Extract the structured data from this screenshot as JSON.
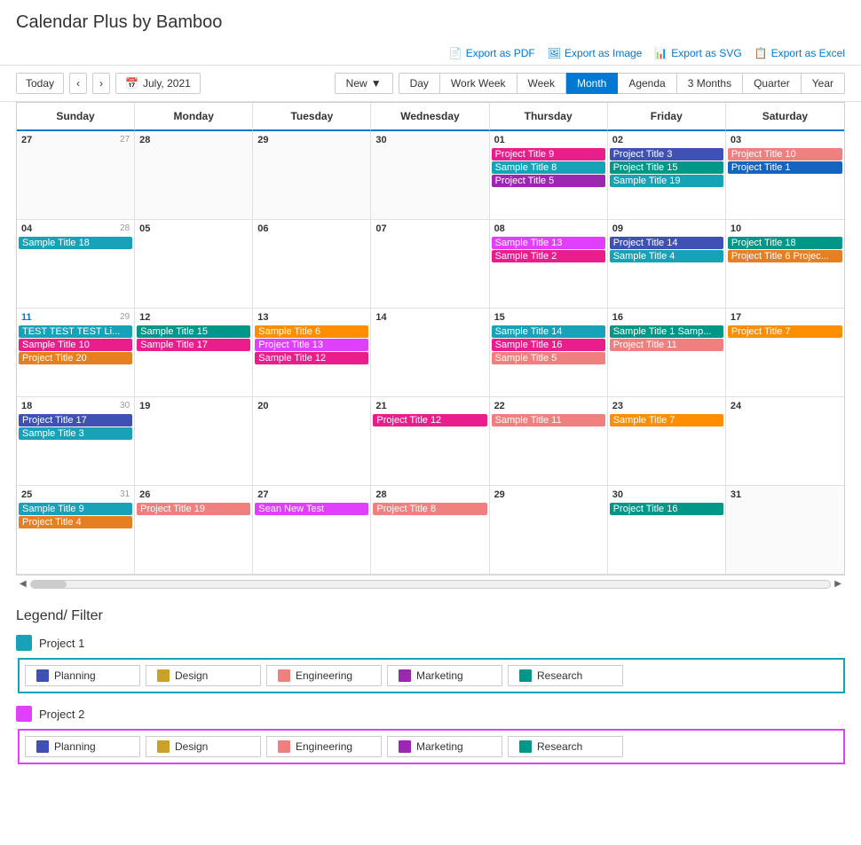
{
  "app": {
    "title": "Calendar Plus by Bamboo"
  },
  "toolbar": {
    "export_pdf": "Export as PDF",
    "export_image": "Export as Image",
    "export_svg": "Export as SVG",
    "export_excel": "Export as Excel"
  },
  "nav": {
    "today": "Today",
    "prev": "‹",
    "next": "›",
    "current_date": "July, 2021",
    "new_label": "New",
    "views": [
      "Day",
      "Work Week",
      "Week",
      "Month",
      "Agenda",
      "3 Months",
      "Quarter",
      "Year"
    ],
    "active_view": "Month"
  },
  "calendar": {
    "headers": [
      "Sunday",
      "Monday",
      "Tuesday",
      "Wednesday",
      "Thursday",
      "Friday",
      "Saturday"
    ],
    "weeks": [
      {
        "week_num": "27",
        "days": [
          {
            "num": "27",
            "other": true,
            "events": []
          },
          {
            "num": "28",
            "other": true,
            "events": []
          },
          {
            "num": "29",
            "other": true,
            "events": []
          },
          {
            "num": "30",
            "other": true,
            "events": []
          },
          {
            "num": "01",
            "events": [
              {
                "label": "Project Title 9",
                "color": "ev-pink"
              },
              {
                "label": "Sample Title 8",
                "color": "ev-cyan"
              },
              {
                "label": "Project Title 5",
                "color": "ev-purple"
              }
            ]
          },
          {
            "num": "02",
            "events": [
              {
                "label": "Project Title 3",
                "color": "ev-blue"
              },
              {
                "label": "Project Title 15",
                "color": "ev-teal"
              },
              {
                "label": "Sample Title 19",
                "color": "ev-cyan"
              }
            ]
          },
          {
            "num": "03",
            "events": [
              {
                "label": "Project Title 10",
                "color": "ev-salmon"
              },
              {
                "label": "Project Title 1",
                "color": "ev-darkblue"
              }
            ]
          }
        ]
      },
      {
        "week_num": "28",
        "days": [
          {
            "num": "04",
            "events": [
              {
                "label": "Sample Title 18",
                "color": "ev-cyan"
              }
            ]
          },
          {
            "num": "05",
            "events": []
          },
          {
            "num": "06",
            "events": []
          },
          {
            "num": "07",
            "events": []
          },
          {
            "num": "08",
            "events": [
              {
                "label": "Sample Title 13",
                "color": "ev-magenta"
              },
              {
                "label": "Sample Title 2",
                "color": "ev-pink"
              }
            ]
          },
          {
            "num": "09",
            "events": [
              {
                "label": "Project Title 14",
                "color": "ev-blue"
              },
              {
                "label": "Sample Title 4",
                "color": "ev-cyan"
              }
            ]
          },
          {
            "num": "10",
            "events": [
              {
                "label": "Project Title 18",
                "color": "ev-teal"
              },
              {
                "label": "Project Title 6 Projec...",
                "color": "ev-orange"
              }
            ]
          }
        ]
      },
      {
        "week_num": "29",
        "days": [
          {
            "num": "11",
            "linked": true,
            "events": [
              {
                "label": "TEST TEST TEST Li...",
                "color": "ev-cyan"
              },
              {
                "label": "Sample Title 10",
                "color": "ev-pink"
              },
              {
                "label": "Project Title 20",
                "color": "ev-orange"
              }
            ]
          },
          {
            "num": "12",
            "events": [
              {
                "label": "Sample Title 15",
                "color": "ev-teal"
              },
              {
                "label": "Sample Title 17",
                "color": "ev-pink"
              }
            ]
          },
          {
            "num": "13",
            "events": [
              {
                "label": "Sample Title 6",
                "color": "ev-amber"
              },
              {
                "label": "Project Title 13",
                "color": "ev-magenta"
              },
              {
                "label": "Sample Title 12",
                "color": "ev-pink"
              }
            ]
          },
          {
            "num": "14",
            "events": []
          },
          {
            "num": "15",
            "events": [
              {
                "label": "Sample Title 14",
                "color": "ev-cyan"
              },
              {
                "label": "Sample Title 16",
                "color": "ev-pink"
              },
              {
                "label": "Sample Title 5",
                "color": "ev-salmon"
              }
            ]
          },
          {
            "num": "16",
            "events": [
              {
                "label": "Sample Title 1 Samp...",
                "color": "ev-teal"
              },
              {
                "label": "Project Title 11",
                "color": "ev-salmon"
              }
            ]
          },
          {
            "num": "17",
            "events": [
              {
                "label": "Project Title 7",
                "color": "ev-amber"
              }
            ]
          }
        ]
      },
      {
        "week_num": "30",
        "days": [
          {
            "num": "18",
            "events": [
              {
                "label": "Project Title 17",
                "color": "ev-blue"
              },
              {
                "label": "Sample Title 3",
                "color": "ev-cyan"
              }
            ]
          },
          {
            "num": "19",
            "events": []
          },
          {
            "num": "20",
            "events": []
          },
          {
            "num": "21",
            "events": [
              {
                "label": "Project Title 12",
                "color": "ev-pink"
              }
            ]
          },
          {
            "num": "22",
            "events": [
              {
                "label": "Sample Title 11",
                "color": "ev-salmon"
              }
            ]
          },
          {
            "num": "23",
            "events": [
              {
                "label": "Sample Title 7",
                "color": "ev-amber"
              }
            ]
          },
          {
            "num": "24",
            "events": []
          }
        ]
      },
      {
        "week_num": "31",
        "days": [
          {
            "num": "25",
            "events": [
              {
                "label": "Sample Title 9",
                "color": "ev-cyan"
              },
              {
                "label": "Project Title 4",
                "color": "ev-orange"
              }
            ]
          },
          {
            "num": "26",
            "events": [
              {
                "label": "Project Title 19",
                "color": "ev-salmon"
              }
            ]
          },
          {
            "num": "27",
            "events": [
              {
                "label": "Sean New Test",
                "color": "ev-magenta"
              }
            ]
          },
          {
            "num": "28",
            "events": [
              {
                "label": "Project Title 8",
                "color": "ev-salmon"
              }
            ]
          },
          {
            "num": "29",
            "events": []
          },
          {
            "num": "30",
            "events": [
              {
                "label": "Project Title 16",
                "color": "ev-teal"
              }
            ]
          },
          {
            "num": "31",
            "other": true,
            "events": []
          }
        ]
      }
    ]
  },
  "legend": {
    "title": "Legend/ Filter",
    "projects": [
      {
        "label": "Project 1",
        "badge_class": "project1-badge",
        "border_class": "project1-border",
        "categories": [
          {
            "label": "Planning",
            "color": "#3f51b5"
          },
          {
            "label": "Design",
            "color": "#c9a227"
          },
          {
            "label": "Engineering",
            "color": "#f08080"
          },
          {
            "label": "Marketing",
            "color": "#9c27b0"
          },
          {
            "label": "Research",
            "color": "#009688"
          }
        ]
      },
      {
        "label": "Project 2",
        "badge_class": "project2-badge",
        "border_class": "project2-border",
        "categories": [
          {
            "label": "Planning",
            "color": "#3f51b5"
          },
          {
            "label": "Design",
            "color": "#c9a227"
          },
          {
            "label": "Engineering",
            "color": "#f08080"
          },
          {
            "label": "Marketing",
            "color": "#9c27b0"
          },
          {
            "label": "Research",
            "color": "#009688"
          }
        ]
      }
    ]
  }
}
